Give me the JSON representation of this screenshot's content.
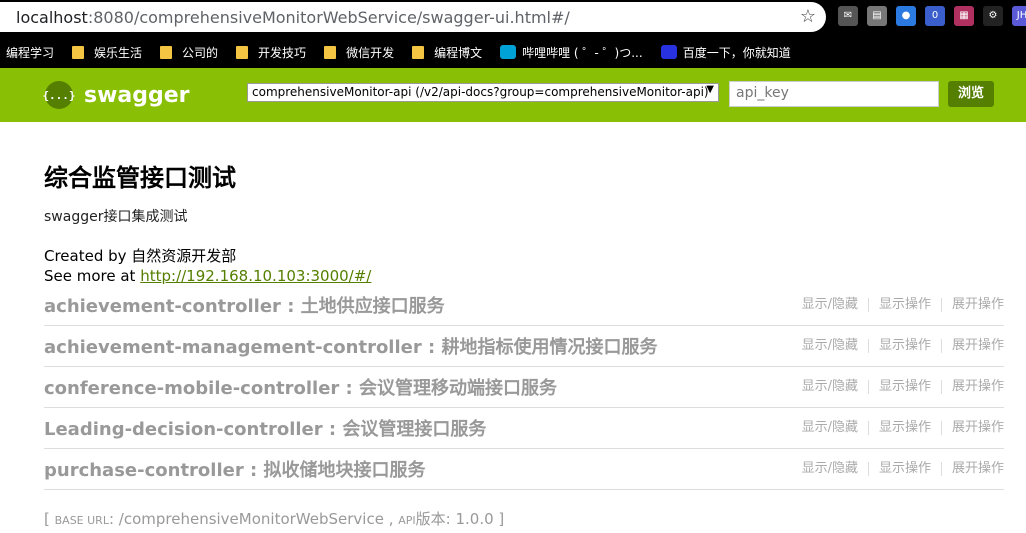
{
  "browser": {
    "url_host": "localhost",
    "url_path": ":8080/comprehensiveMonitorWebService/swagger-ui.html#/",
    "extensions": [
      {
        "icon": "mail-icon",
        "color": "#555",
        "text": "✉"
      },
      {
        "icon": "notes-icon",
        "color": "#777",
        "text": "▤"
      },
      {
        "icon": "globe-icon",
        "color": "#2a7ae2",
        "text": "●"
      },
      {
        "icon": "badge-icon",
        "color": "#3a5fcd",
        "text": "0"
      },
      {
        "icon": "puzzle-icon",
        "color": "#b03060",
        "text": "▦"
      },
      {
        "icon": "gear-icon",
        "color": "#222",
        "text": "⚙"
      },
      {
        "icon": "user-icon",
        "color": "#5a5ad6",
        "text": "JH"
      }
    ],
    "bookmarks": [
      "编程学习",
      "娱乐生活",
      "公司的",
      "开发技巧",
      "微信开发",
      "编程博文",
      "哔哩哔哩 ( ゜- ゜)つ...",
      "百度一下，你就知道"
    ]
  },
  "header": {
    "logo_icon": "{...}",
    "logo_text": "swagger",
    "api_select_value": "comprehensiveMonitor-api (/v2/api-docs?group=comprehensiveMonitor-api)",
    "api_key_placeholder": "api_key",
    "explore_label": "浏览"
  },
  "info": {
    "title": "综合监管接口测试",
    "description": "swagger接口集成测试",
    "created_by": "Created by 自然资源开发部",
    "see_more_prefix": "See more at ",
    "see_more_link": "http://192.168.10.103:3000/#/"
  },
  "resources": [
    {
      "name": "achievement-controller : 土地供应接口服务"
    },
    {
      "name": "achievement-management-controller : 耕地指标使用情况接口服务"
    },
    {
      "name": "conference-mobile-controller : 会议管理移动端接口服务"
    },
    {
      "name": "Leading-decision-controller : 会议管理接口服务"
    },
    {
      "name": "purchase-controller : 拟收储地块接口服务"
    }
  ],
  "ops": {
    "show_hide": "显示/隐藏",
    "list_operations": "显示操作",
    "expand_operations": "展开操作"
  },
  "footer": {
    "open_bracket": "[ ",
    "base_url_label": "BASE URL",
    "base_url_value": ": /comprehensiveMonitorWebService , ",
    "api_version_label": "API",
    "api_version_value": "版本: 1.0.0 ]"
  }
}
